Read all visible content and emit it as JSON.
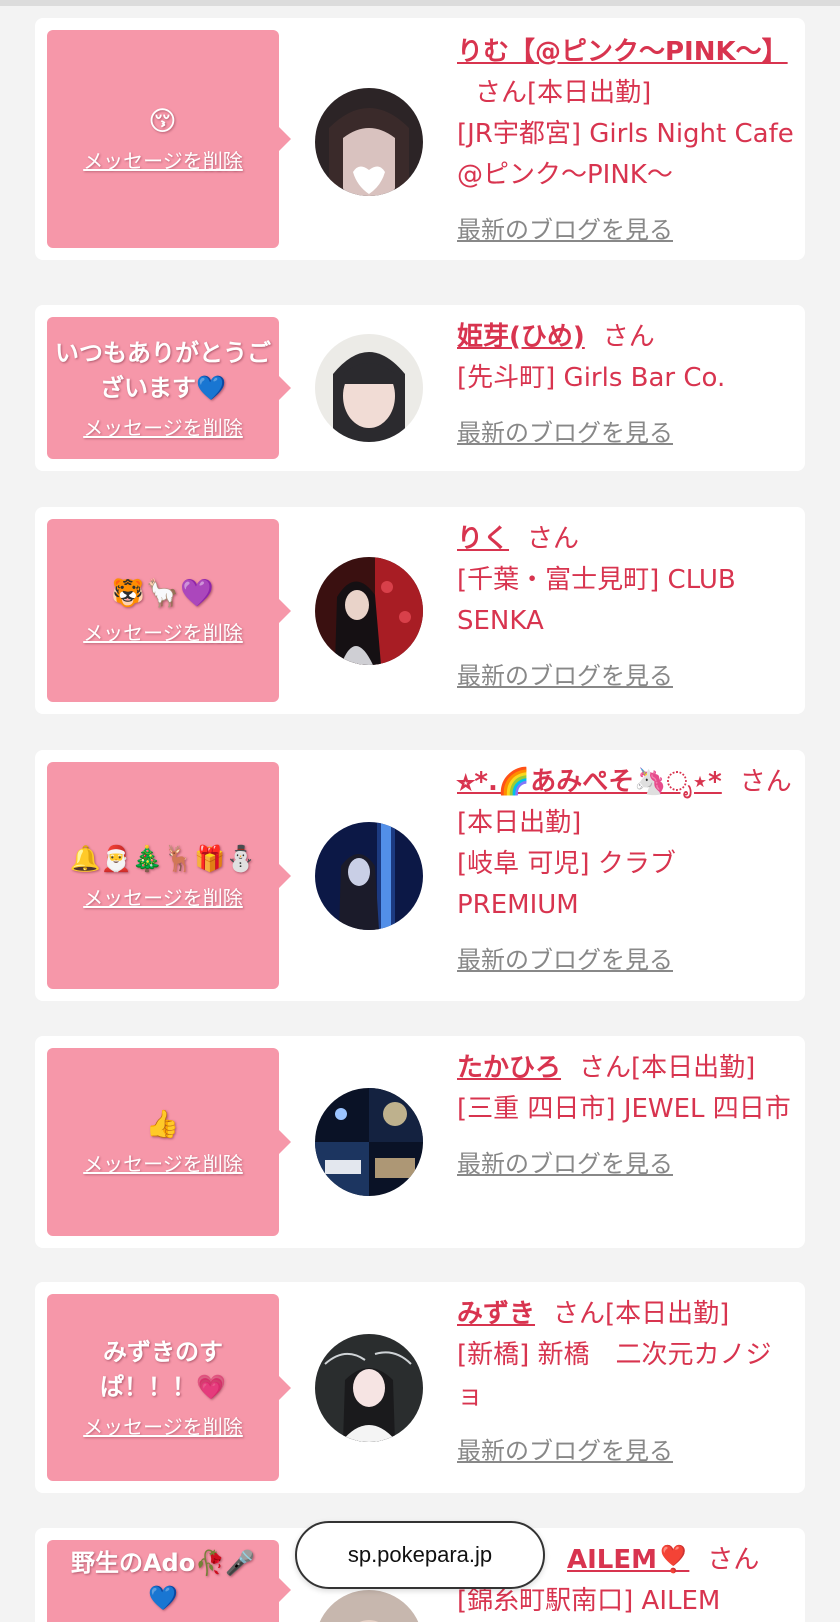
{
  "browser": {
    "url": "sp.pokepara.jp"
  },
  "labels": {
    "delete_message": "メッセージを削除",
    "view_blog": "最新のブログを見る",
    "san": "さん"
  },
  "entries": [
    {
      "message": "😚",
      "name": "りむ【@ピンク〜PINK〜】",
      "status": "[本日出勤]",
      "shop": "[JR宇都宮] Girls Night Cafe @ピンク〜PINK〜",
      "avatar": "dark-photo"
    },
    {
      "message": "いつもありがとうございます💙",
      "name": "姫芽(ひめ)",
      "status": "",
      "shop": "[先斗町] Girls Bar Co.",
      "avatar": "light-photo"
    },
    {
      "message": "🐯🦙💜",
      "name": "りく",
      "status": "",
      "shop": "[千葉・富士見町] CLUB SENKA",
      "avatar": "red-sofa-photo"
    },
    {
      "message": "🔔🎅🎄🦌🎁⛄",
      "name": "⭐︎*.🌈あみぺそ🦄ೃ⋆*",
      "status": "[本日出勤]",
      "shop": "[岐阜 可児] クラブPREMIUM",
      "avatar": "blue-light-photo"
    },
    {
      "message": "👍",
      "name": "たかひろ",
      "status": "[本日出勤]",
      "shop": "[三重 四日市] JEWEL 四日市",
      "avatar": "fireworks-photo"
    },
    {
      "message": "みずきのすぱ！！！💗",
      "name": "みずき",
      "status": "[本日出勤]",
      "shop": "[新橋] 新橋　二次元カノジョ",
      "avatar": "chalkboard-photo"
    },
    {
      "message": "野生のAdo🥀🎤💙",
      "name": "AILEM❣️",
      "status": "",
      "shop": "[錦糸町駅南口] AILEM",
      "avatar": "partial-photo"
    }
  ]
}
